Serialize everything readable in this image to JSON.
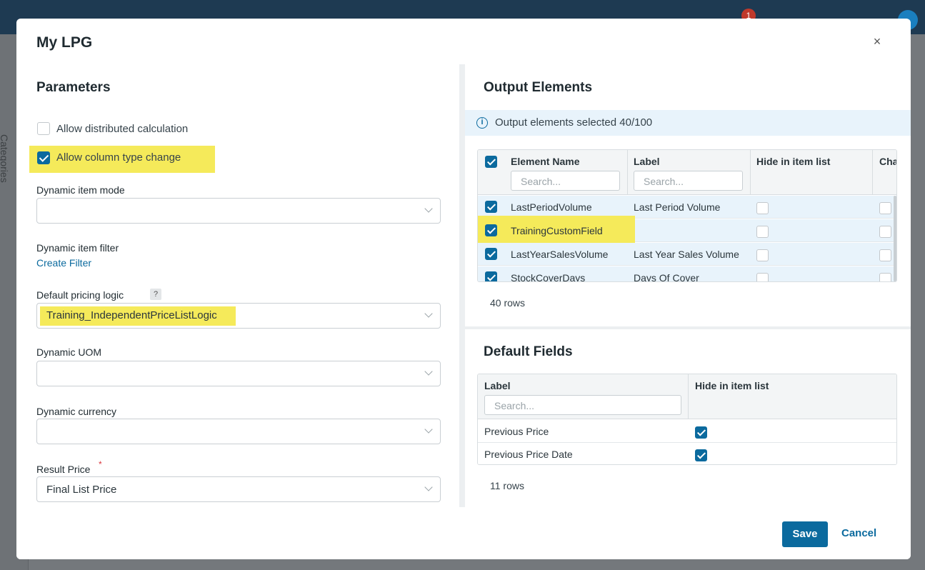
{
  "background": {
    "sidebar_label": "Categories",
    "notification_count": "1"
  },
  "modal": {
    "title": "My LPG",
    "close_symbol": "×"
  },
  "parameters": {
    "title": "Parameters",
    "allow_distributed": {
      "label": "Allow distributed calculation",
      "checked": false
    },
    "allow_column_type": {
      "label": "Allow column type change",
      "checked": true
    },
    "dynamic_item_mode": {
      "label": "Dynamic item mode",
      "value": ""
    },
    "dynamic_item_filter": {
      "label": "Dynamic item filter",
      "link": "Create Filter"
    },
    "default_pricing_logic": {
      "label": "Default pricing logic",
      "help": "?",
      "value": "Training_IndependentPriceListLogic"
    },
    "dynamic_uom": {
      "label": "Dynamic UOM",
      "value": ""
    },
    "dynamic_currency": {
      "label": "Dynamic currency",
      "value": ""
    },
    "result_price": {
      "label": "Result Price",
      "required_mark": "*",
      "value": "Final List Price"
    }
  },
  "output_elements": {
    "title": "Output Elements",
    "info": "Output elements selected 40/100",
    "columns": {
      "element_name": "Element Name",
      "label": "Label",
      "hide": "Hide in item list",
      "cha": "Cha"
    },
    "search_placeholder": "Search...",
    "rows": [
      {
        "name": "LastPeriodVolume",
        "label": "Last Period Volume",
        "checked": true
      },
      {
        "name": "TrainingCustomField",
        "label": "",
        "checked": true
      },
      {
        "name": "LastYearSalesVolume",
        "label": "Last Year Sales Volume",
        "checked": true
      },
      {
        "name": "StockCoverDays",
        "label": "Days Of Cover",
        "checked": true
      }
    ],
    "row_count": "40 rows"
  },
  "default_fields": {
    "title": "Default Fields",
    "columns": {
      "label": "Label",
      "hide": "Hide in item list"
    },
    "search_placeholder": "Search...",
    "rows": [
      {
        "label": "Previous Price",
        "hide": true
      },
      {
        "label": "Previous Price Date",
        "hide": true
      }
    ],
    "row_count": "11 rows"
  },
  "footer": {
    "save": "Save",
    "cancel": "Cancel"
  },
  "colors": {
    "accent": "#0b6a9e",
    "highlight": "#f5ea5a",
    "info_bg": "#e8f3fb"
  }
}
